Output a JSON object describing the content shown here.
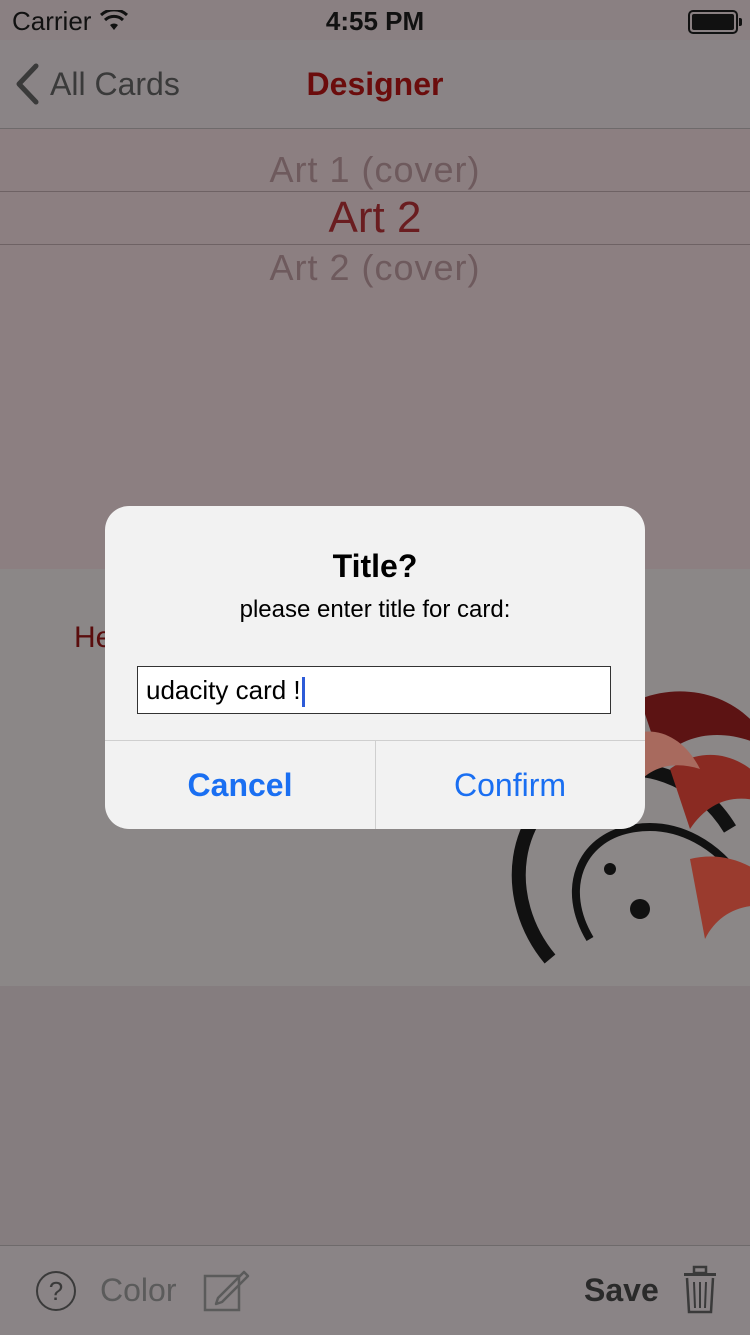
{
  "status_bar": {
    "carrier": "Carrier",
    "time": "4:55 PM"
  },
  "nav": {
    "back_label": "All Cards",
    "title": "Designer"
  },
  "picker": {
    "rows": [
      "Art 1 (cover)",
      "Art 2",
      "Art 2 (cover)"
    ]
  },
  "card": {
    "greeting": "He"
  },
  "alert": {
    "title": "Title?",
    "message": "please enter title for card:",
    "input_value": "udacity card !",
    "cancel_label": "Cancel",
    "confirm_label": "Confirm"
  },
  "toolbar": {
    "help_label": "?",
    "color_label": "Color",
    "save_label": "Save"
  },
  "colors": {
    "accent_blue": "#1a6ff2",
    "title_red": "#6b0c0c"
  }
}
